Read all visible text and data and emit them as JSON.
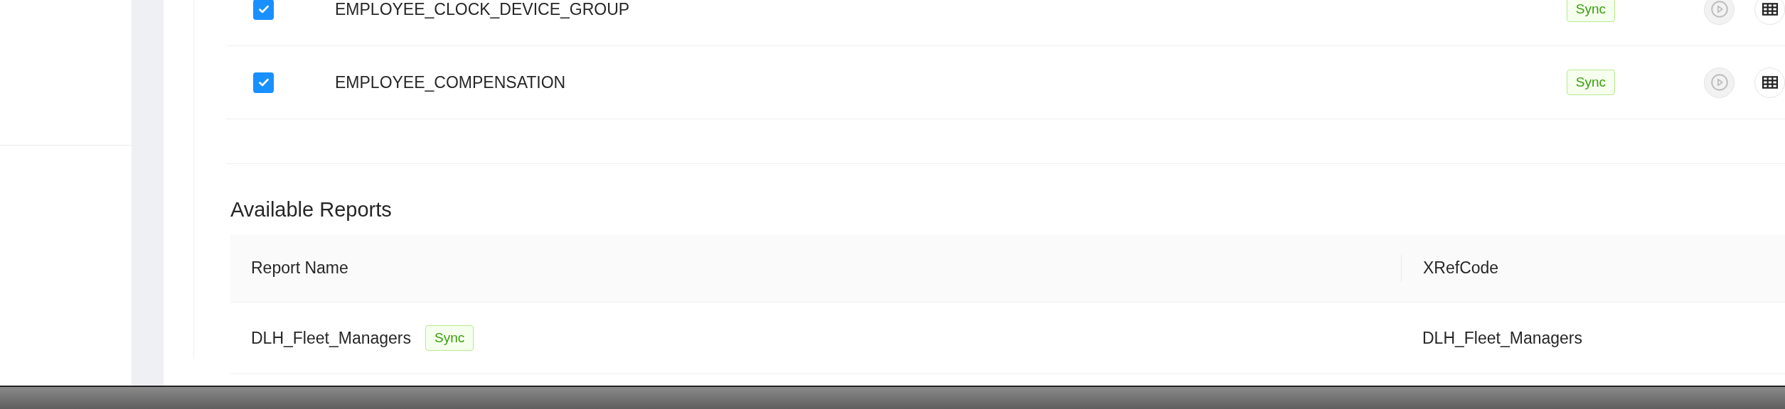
{
  "entities": [
    {
      "name": "EMPLOYEE_CLOCK_DEVICE_GROUP",
      "checked": true,
      "tag": "Sync"
    },
    {
      "name": "EMPLOYEE_COMPENSATION",
      "checked": true,
      "tag": "Sync"
    }
  ],
  "reports": {
    "title": "Available Reports",
    "columns": [
      "Report Name",
      "XRefCode"
    ],
    "rows": [
      {
        "name": "DLH_Fleet_Managers",
        "tag": "Sync",
        "xref": "DLH_Fleet_Managers"
      }
    ]
  }
}
